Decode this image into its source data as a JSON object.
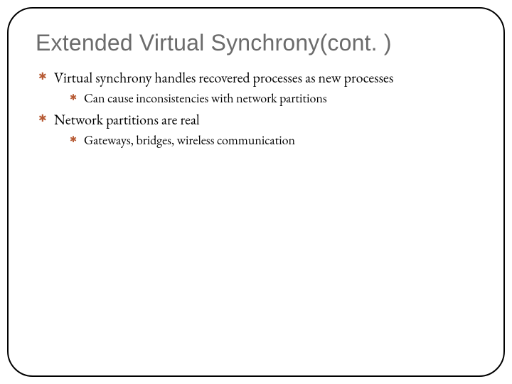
{
  "slide": {
    "title": "Extended Virtual Synchrony(cont. )",
    "bullets": [
      {
        "text": "Virtual synchrony handles recovered processes as new processes",
        "children": [
          {
            "text": "Can cause inconsistencies with network partitions"
          }
        ]
      },
      {
        "text": "Network partitions are real",
        "children": [
          {
            "text": "Gateways, bridges, wireless communication"
          }
        ]
      }
    ]
  }
}
